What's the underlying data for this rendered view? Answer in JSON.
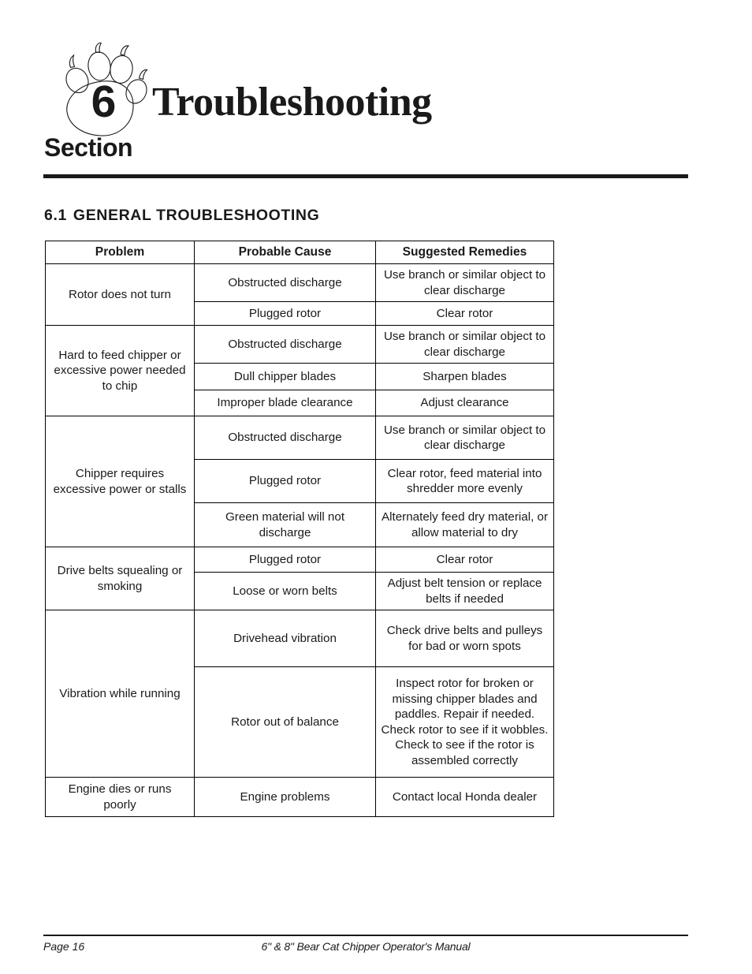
{
  "page": {
    "section_number": "6",
    "section_word": "Section",
    "section_title": "Troubleshooting",
    "logo_icon": "bear-paw-print-icon"
  },
  "subsection": {
    "number": "6.1",
    "title": "GENERAL  TROUBLESHOOTING"
  },
  "table": {
    "headers": {
      "problem": "Problem",
      "cause": "Probable Cause",
      "remedy": "Suggested Remedies"
    },
    "groups": [
      {
        "problem": "Rotor does not turn",
        "rows": [
          {
            "cause": "Obstructed discharge",
            "remedy": "Use branch or similar object to clear discharge"
          },
          {
            "cause": "Plugged rotor",
            "remedy": "Clear rotor"
          }
        ]
      },
      {
        "problem": "Hard to feed chipper or excessive power needed to chip",
        "rows": [
          {
            "cause": "Obstructed discharge",
            "remedy": "Use branch or similar object to clear discharge"
          },
          {
            "cause": "Dull chipper blades",
            "remedy": "Sharpen blades"
          },
          {
            "cause": "Improper blade clearance",
            "remedy": "Adjust clearance"
          }
        ]
      },
      {
        "problem": "Chipper requires excessive power or stalls",
        "rows": [
          {
            "cause": "Obstructed discharge",
            "remedy": "Use branch or similar object to clear discharge"
          },
          {
            "cause": "Plugged rotor",
            "remedy": "Clear rotor, feed material into shredder more evenly"
          },
          {
            "cause": "Green material will not discharge",
            "remedy": "Alternately feed dry material, or allow material to dry"
          }
        ]
      },
      {
        "problem": "Drive belts squealing or smoking",
        "rows": [
          {
            "cause": "Plugged rotor",
            "remedy": "Clear rotor"
          },
          {
            "cause": "Loose or worn belts",
            "remedy": "Adjust belt tension or replace belts if needed"
          }
        ]
      },
      {
        "problem": "Vibration while running",
        "rows": [
          {
            "cause": "Drivehead vibration",
            "remedy": "Check drive belts and pulleys for bad or worn spots"
          },
          {
            "cause": "Rotor out of balance",
            "remedy": "Inspect rotor for broken or missing chipper blades and paddles. Repair if needed. Check rotor to see if it wobbles. Check to see if the rotor is assembled correctly"
          }
        ]
      },
      {
        "problem": "Engine dies or runs poorly",
        "rows": [
          {
            "cause": "Engine problems",
            "remedy": "Contact local Honda dealer"
          }
        ]
      }
    ]
  },
  "footer": {
    "page_label": "Page 16",
    "manual_title": "6\" & 8\" Bear Cat Chipper Operator's Manual"
  }
}
